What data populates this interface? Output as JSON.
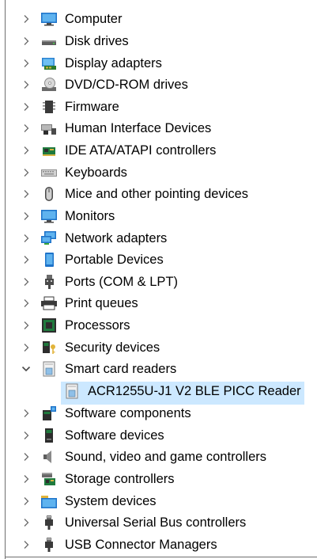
{
  "device_tree": {
    "items": [
      {
        "label": "Computer",
        "icon": "monitor-icon",
        "expanded": false
      },
      {
        "label": "Disk drives",
        "icon": "disk-drive-icon",
        "expanded": false
      },
      {
        "label": "Display adapters",
        "icon": "display-adapter-icon",
        "expanded": false
      },
      {
        "label": "DVD/CD-ROM drives",
        "icon": "dvd-drive-icon",
        "expanded": false
      },
      {
        "label": "Firmware",
        "icon": "firmware-chip-icon",
        "expanded": false
      },
      {
        "label": "Human Interface Devices",
        "icon": "hid-icon",
        "expanded": false
      },
      {
        "label": "IDE ATA/ATAPI controllers",
        "icon": "ide-controller-icon",
        "expanded": false
      },
      {
        "label": "Keyboards",
        "icon": "keyboard-icon",
        "expanded": false
      },
      {
        "label": "Mice and other pointing devices",
        "icon": "mouse-icon",
        "expanded": false
      },
      {
        "label": "Monitors",
        "icon": "monitor-icon",
        "expanded": false
      },
      {
        "label": "Network adapters",
        "icon": "network-adapter-icon",
        "expanded": false
      },
      {
        "label": "Portable Devices",
        "icon": "portable-device-icon",
        "expanded": false
      },
      {
        "label": "Ports (COM & LPT)",
        "icon": "port-icon",
        "expanded": false
      },
      {
        "label": "Print queues",
        "icon": "printer-icon",
        "expanded": false
      },
      {
        "label": "Processors",
        "icon": "processor-icon",
        "expanded": false
      },
      {
        "label": "Security devices",
        "icon": "security-device-icon",
        "expanded": false
      },
      {
        "label": "Smart card readers",
        "icon": "smart-card-reader-icon",
        "expanded": true
      },
      {
        "label": "ACR1255U-J1 V2 BLE PICC Reader",
        "icon": "smart-card-reader-icon",
        "child": true,
        "selected": true
      },
      {
        "label": "Software components",
        "icon": "software-component-icon",
        "expanded": false
      },
      {
        "label": "Software devices",
        "icon": "software-device-icon",
        "expanded": false
      },
      {
        "label": "Sound, video and game controllers",
        "icon": "speaker-icon",
        "expanded": false
      },
      {
        "label": "Storage controllers",
        "icon": "storage-controller-icon",
        "expanded": false
      },
      {
        "label": "System devices",
        "icon": "system-devices-icon",
        "expanded": false
      },
      {
        "label": "Universal Serial Bus controllers",
        "icon": "usb-icon",
        "expanded": false
      },
      {
        "label": "USB Connector Managers",
        "icon": "usb-icon",
        "expanded": false
      }
    ]
  },
  "colors": {
    "selection_bg": "#cce8ff",
    "chevron": "#6a6a6a",
    "text": "#000000"
  }
}
